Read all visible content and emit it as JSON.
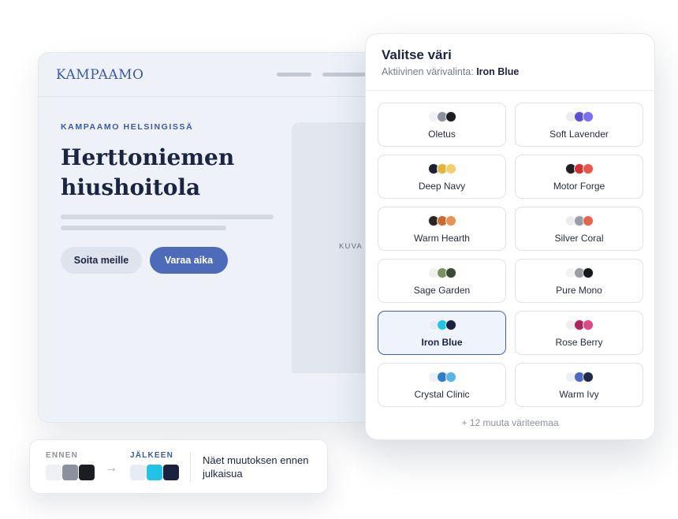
{
  "site": {
    "logo": "KAMPAAMO",
    "eyebrow": "KAMPAAMO HELSINGISSÄ",
    "title": "Herttoniemen hiushoitola",
    "buttons": {
      "call": "Soita meille",
      "book": "Varaa aika"
    },
    "image_label": "KUVA :"
  },
  "picker": {
    "title": "Valitse väri",
    "subtitle_prefix": "Aktiivinen värivalinta:",
    "active_theme": "Iron Blue",
    "themes": [
      {
        "name": "Oletus",
        "colors": [
          "#eef1f8",
          "#8b919e",
          "#1c1d22"
        ]
      },
      {
        "name": "Soft Lavender",
        "colors": [
          "#ececf4",
          "#5b4fd6",
          "#7b6ef0"
        ]
      },
      {
        "name": "Deep Navy",
        "colors": [
          "#1c2236",
          "#e3b43c",
          "#f0cf6c"
        ]
      },
      {
        "name": "Motor Forge",
        "colors": [
          "#1f1f23",
          "#d13232",
          "#e8574d"
        ]
      },
      {
        "name": "Warm Hearth",
        "colors": [
          "#2a2522",
          "#c96c2e",
          "#e49454"
        ]
      },
      {
        "name": "Silver Coral",
        "colors": [
          "#ececef",
          "#9a9da6",
          "#e0664e"
        ]
      },
      {
        "name": "Sage Garden",
        "colors": [
          "#eef0ea",
          "#7b9063",
          "#3b4a35"
        ]
      },
      {
        "name": "Pure Mono",
        "colors": [
          "#f2f2f3",
          "#9b9ca1",
          "#17181b"
        ]
      },
      {
        "name": "Iron Blue",
        "colors": [
          "#e6ebf4",
          "#22c3e6",
          "#1a2140"
        ]
      },
      {
        "name": "Rose Berry",
        "colors": [
          "#f3ecef",
          "#a8265a",
          "#db4b85"
        ]
      },
      {
        "name": "Crystal Clinic",
        "colors": [
          "#eaf1f7",
          "#2e7ec7",
          "#5bb3e6"
        ]
      },
      {
        "name": "Warm Ivy",
        "colors": [
          "#eeeff4",
          "#4f67c4",
          "#1f2a48"
        ]
      }
    ],
    "more": "+ 12 muuta väriteemaa"
  },
  "compare": {
    "before_label": "ENNEN",
    "after_label": "JÄLKEEN",
    "arrow": "→",
    "before_colors": [
      "#eef0f6",
      "#8b919e",
      "#1c1d22"
    ],
    "after_colors": [
      "#e6ebf4",
      "#22c3e6",
      "#1a2140"
    ],
    "note": "Näet muutoksen ennen julkaisua"
  }
}
